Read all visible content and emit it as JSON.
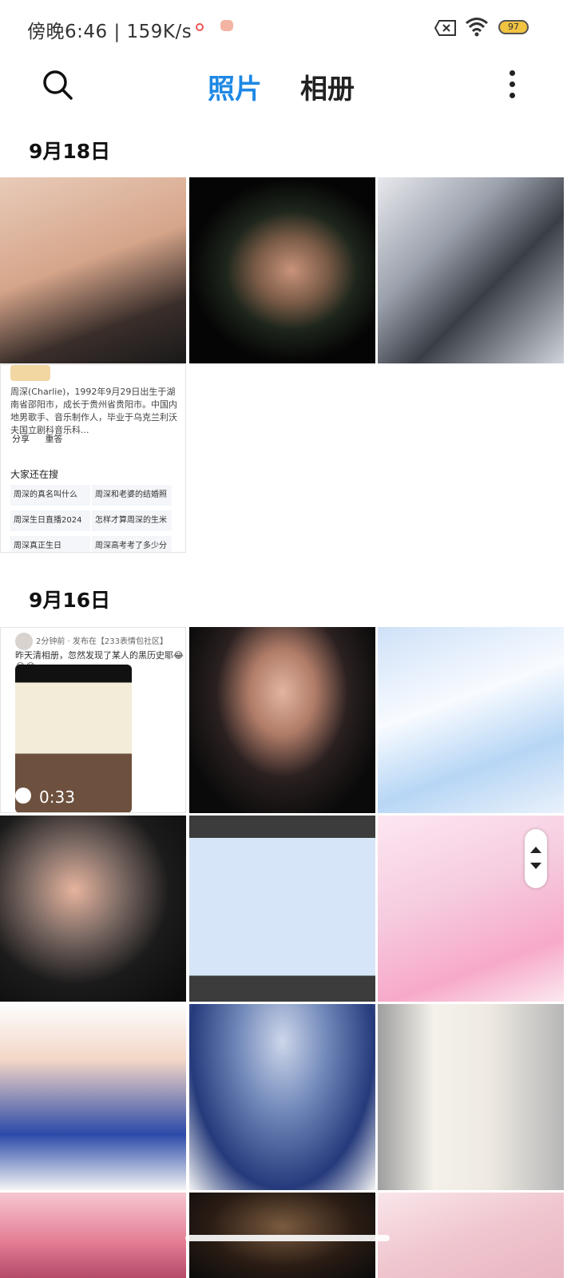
{
  "status_bar": {
    "time_speed": "傍晚6:46 | 159K/s",
    "battery": "97"
  },
  "top_bar": {
    "tabs": [
      {
        "label": "照片",
        "active": true
      },
      {
        "label": "相册",
        "active": false
      }
    ],
    "accent_color": "#1e88e5"
  },
  "sections": [
    {
      "date": "9月18日"
    },
    {
      "date": "9月16日"
    }
  ],
  "screenshot_tile_1": {
    "intro": "周深(Charlie)，1992年9月29日出生于湖南省邵阳市，成长于贵州省贵阳市。中国内地男歌手、音乐制作人，毕业于乌克兰利沃夫国立剧科音乐科...",
    "share": "分享",
    "redo": "重答",
    "others_search_title": "大家还在搜",
    "chips": [
      "周深的真名叫什么",
      "周深和老婆的结婚照",
      "周深生日直播2024",
      "怎样才算周深的生米",
      "周深真正生日",
      "周深高考考了多少分"
    ]
  },
  "screenshot_tile_2": {
    "meta": "2分钟前 · 发布在【233表情包社区】",
    "post": "昨天清相册，忽然发现了某人的黑历史耶😂😂😂",
    "duration": "0:33"
  }
}
